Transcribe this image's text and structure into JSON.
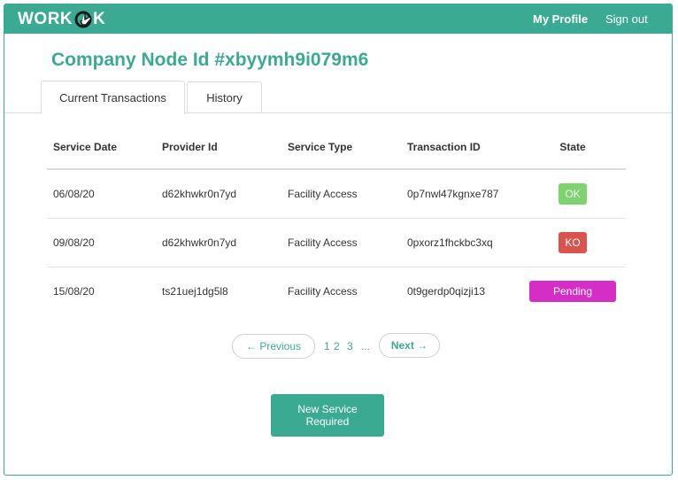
{
  "brand": {
    "prefix": "WORK",
    "suffix": "K"
  },
  "nav": {
    "profile": "My Profile",
    "signout": "Sign out"
  },
  "page_title": "Company Node Id #xbyymh9i079m6",
  "tabs": [
    {
      "label": "Current Transactions",
      "active": true
    },
    {
      "label": "History",
      "active": false
    }
  ],
  "table": {
    "headers": [
      "Service Date",
      "Provider Id",
      "Service Type",
      "Transaction ID",
      "State"
    ],
    "rows": [
      {
        "date": "06/08/20",
        "provider": "d62khwkr0n7yd",
        "type": "Facility Access",
        "tx": "0p7nwl47kgnxe787",
        "state": "OK"
      },
      {
        "date": "09/08/20",
        "provider": "d62khwkr0n7yd",
        "type": "Facility Access",
        "tx": "0pxorz1fhckbc3xq",
        "state": "KO"
      },
      {
        "date": "15/08/20",
        "provider": "ts21uej1dg5l8",
        "type": "Facility Access",
        "tx": "0t9gerdp0qizji13",
        "state": "Pending"
      }
    ]
  },
  "pagination": {
    "prev": "← Previous",
    "pages": [
      "1",
      "2",
      "3"
    ],
    "ellipsis": "...",
    "next": "Next →"
  },
  "new_service_button": "New Service Required",
  "colors": {
    "accent": "#3aaa92",
    "ok": "#7dd36e",
    "ko": "#d9534f",
    "pending": "#d52ec7"
  },
  "icons": {
    "logo_mark": "hand-cursor-icon"
  }
}
